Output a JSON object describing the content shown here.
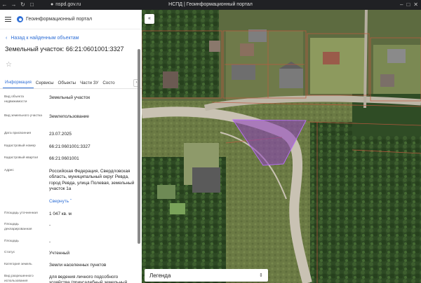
{
  "browser": {
    "back_icon": "arrow-left-icon",
    "forward_icon": "arrow-right-icon",
    "reload_icon": "reload-icon",
    "url": "nspd.gov.ru",
    "tab_title": "НСПД | Геоинформационный портал"
  },
  "header": {
    "portal_name": "Геоинформационный портал"
  },
  "nav": {
    "back_label": "Назад к найденным объектам"
  },
  "object": {
    "title": "Земельный участок: 66:21:0601001:3327"
  },
  "tabs": [
    {
      "label": "Информация"
    },
    {
      "label": "Сервисы"
    },
    {
      "label": "Объекты"
    },
    {
      "label": "Части ЗУ"
    },
    {
      "label": "Состо"
    }
  ],
  "attributes": [
    {
      "label": "Вид объекта недвижимости",
      "value": "Земельный участок"
    },
    {
      "label": "Вид земельного участка",
      "value": "Землепользование"
    },
    {
      "label": "Дата присвоения",
      "value": "23.07.2025"
    },
    {
      "label": "Кадастровый номер",
      "value": "66:21:0601001:3327"
    },
    {
      "label": "Кадастровый квартал",
      "value": "66:21:0601001"
    },
    {
      "label": "Адрес",
      "value": "Российская Федерация, Свердловская область, муниципальный округ Ревда, город Ревда, улица Полевая, земельный участок 1а"
    },
    {
      "label": "",
      "value": "Свернуть"
    },
    {
      "label": "Площадь уточненная",
      "value": "1 047 кв. м"
    },
    {
      "label": "Площадь декларированная",
      "value": "-"
    },
    {
      "label": "Площадь",
      "value": "-"
    },
    {
      "label": "Статус",
      "value": "Учтенный"
    },
    {
      "label": "Категория земель",
      "value": "Земли населенных пунктов"
    },
    {
      "label": "Вид разрешенного использования",
      "value": "для ведения личного подсобного хозяйства (приусадебный земельный участок)"
    }
  ],
  "map": {
    "collapse_icon": "double-chevron-left-icon",
    "legend_label": "Легенда",
    "legend_icon": "chevron-updown-icon",
    "parcel_color": "#8e3fc0"
  }
}
